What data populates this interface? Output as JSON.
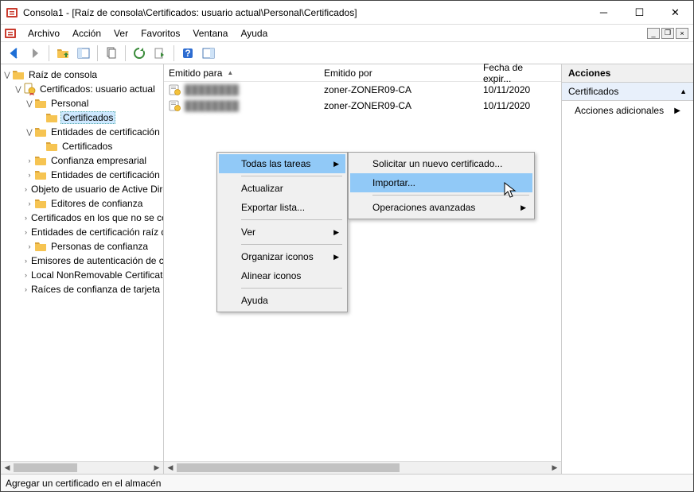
{
  "window": {
    "title": "Consola1 - [Raíz de consola\\Certificados: usuario actual\\Personal\\Certificados]"
  },
  "menu": {
    "items": [
      "Archivo",
      "Acción",
      "Ver",
      "Favoritos",
      "Ventana",
      "Ayuda"
    ]
  },
  "tree": {
    "root": "Raíz de consola",
    "cert_user": "Certificados: usuario actual",
    "personal": "Personal",
    "personal_certs": "Certificados",
    "ent_cert": "Entidades de certificación",
    "ent_cert_certs": "Certificados",
    "nodes": [
      "Confianza empresarial",
      "Entidades de certificación",
      "Objeto de usuario de Active Directory",
      "Editores de confianza",
      "Certificados en los que no se confía",
      "Entidades de certificación raíz de terceros",
      "Personas de confianza",
      "Emisores de autenticación de cliente",
      "Local NonRemovable Certificates",
      "Raíces de confianza de tarjeta inteligente"
    ]
  },
  "list": {
    "cols": {
      "a": "Emitido para",
      "b": "Emitido por",
      "c": "Fecha de expir..."
    },
    "rows": [
      {
        "name": "████████",
        "issuer": "zoner-ZONER09-CA",
        "exp": "10/11/2020"
      },
      {
        "name": "████████",
        "issuer": "zoner-ZONER09-CA",
        "exp": "10/11/2020"
      }
    ]
  },
  "actions": {
    "header": "Acciones",
    "section": "Certificados",
    "more": "Acciones adicionales"
  },
  "ctx1": {
    "tasks": "Todas las tareas",
    "refresh": "Actualizar",
    "export": "Exportar lista...",
    "view": "Ver",
    "arrange": "Organizar iconos",
    "align": "Alinear iconos",
    "help": "Ayuda"
  },
  "ctx2": {
    "request": "Solicitar un nuevo certificado...",
    "import": "Importar...",
    "advanced": "Operaciones avanzadas"
  },
  "status": "Agregar un certificado en el almacén"
}
